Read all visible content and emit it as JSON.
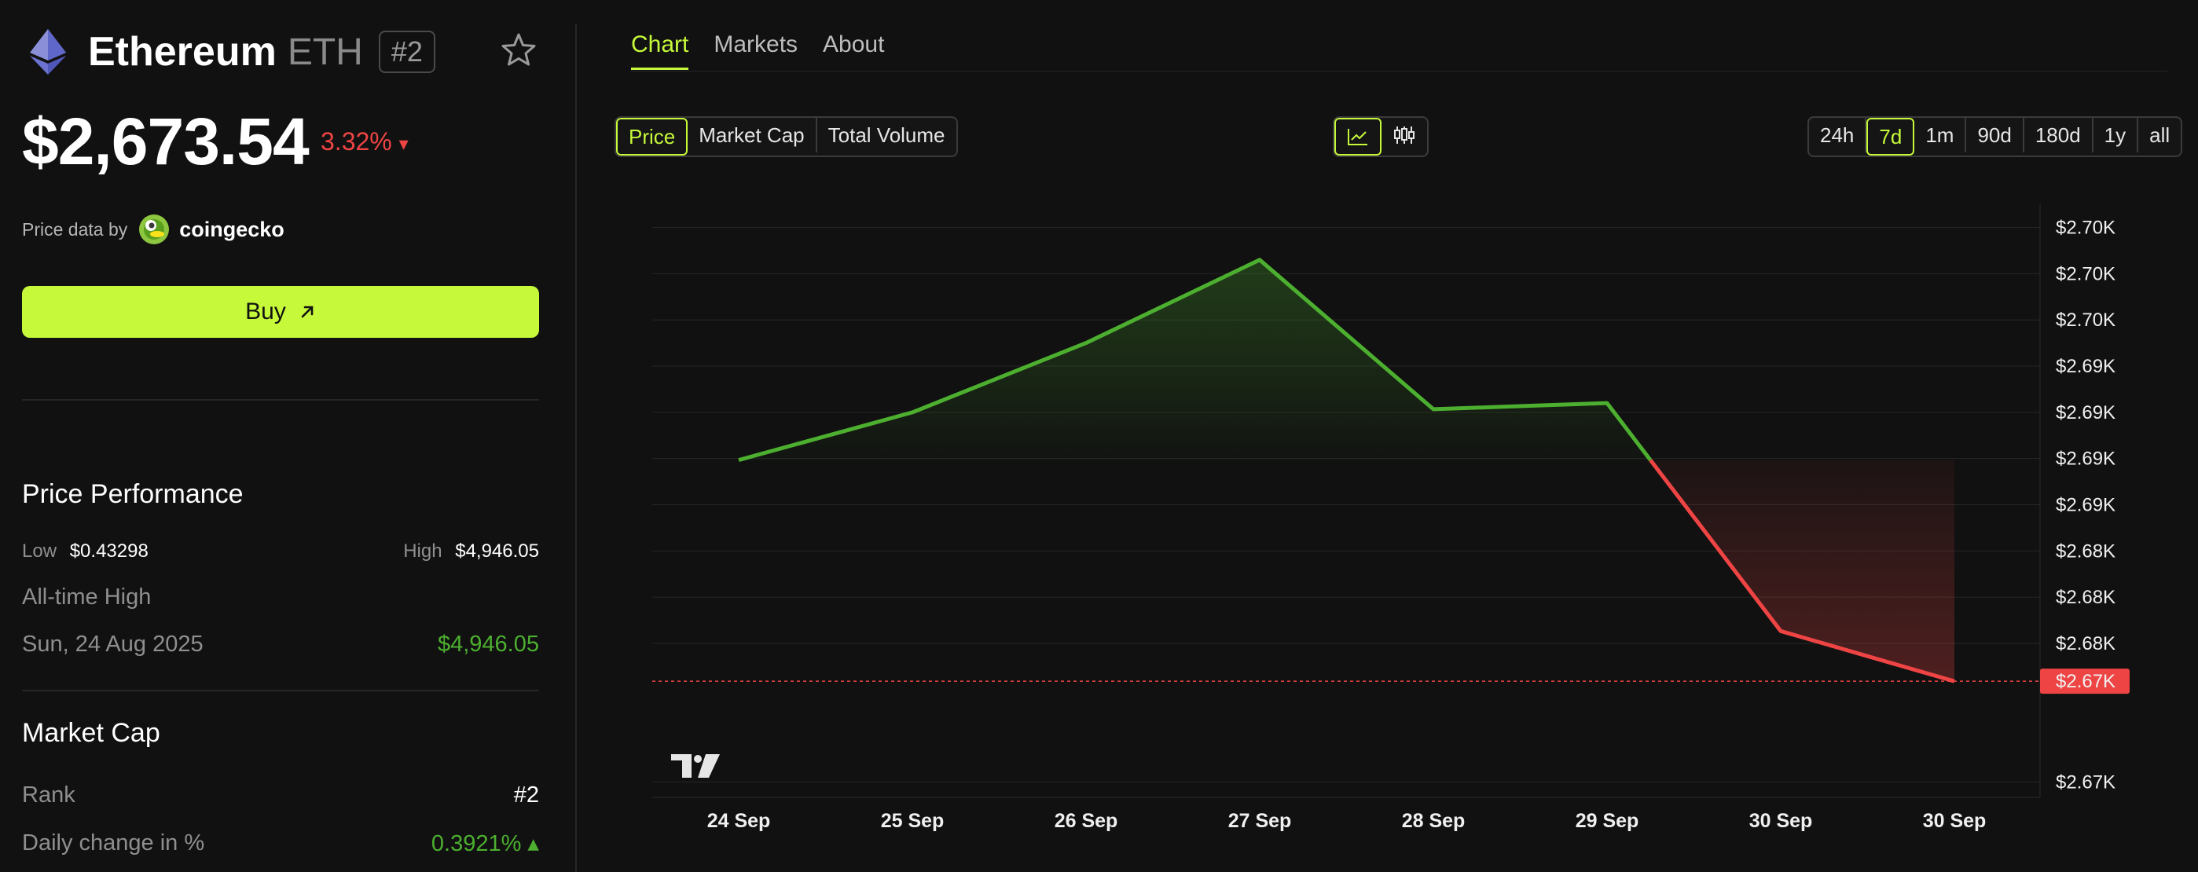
{
  "coin": {
    "name": "Ethereum",
    "symbol": "ETH",
    "rank_badge": "#2",
    "price": "$2,673.54",
    "change": "3.32%",
    "change_arrow": "▾"
  },
  "price_data": {
    "label": "Price data by",
    "provider": "coingecko"
  },
  "buy": {
    "label": "Buy"
  },
  "performance": {
    "title": "Price Performance",
    "low_label": "Low",
    "low_value": "$0.43298",
    "high_label": "High",
    "high_value": "$4,946.05",
    "ath_label": "All-time High",
    "ath_date": "Sun, 24 Aug 2025",
    "ath_value": "$4,946.05"
  },
  "market_cap": {
    "title": "Market Cap",
    "rank_label": "Rank",
    "rank_value": "#2",
    "daily_label": "Daily change in %",
    "daily_value": "0.3921% ▴"
  },
  "tabs": [
    "Chart",
    "Markets",
    "About"
  ],
  "metric_toggle": [
    "Price",
    "Market Cap",
    "Total Volume"
  ],
  "ranges": [
    "24h",
    "7d",
    "1m",
    "90d",
    "180d",
    "1y",
    "all"
  ],
  "colors": {
    "accent": "#c6f93a",
    "up": "#4caf2f",
    "down": "#ef4444",
    "bg": "#111111"
  },
  "icons": {
    "line_chart": "line-chart-icon",
    "candles": "candlestick-icon",
    "star": "star-icon",
    "arrow": "arrow-up-right-icon",
    "watermark": "tradingview-logo"
  },
  "chart_data": {
    "type": "line",
    "x": [
      "24 Sep",
      "25 Sep",
      "26 Sep",
      "27 Sep",
      "28 Sep",
      "29 Sep",
      "30 Sep",
      "30 Sep"
    ],
    "values": [
      2687.9,
      2691.0,
      2695.5,
      2700.9,
      2691.2,
      2691.6,
      2676.8,
      2673.54
    ],
    "ylim": [
      2666.0,
      2704.0
    ],
    "yticks": [
      {
        "v": 2703.0,
        "label": "$2.70K"
      },
      {
        "v": 2700.0,
        "label": "$2.70K"
      },
      {
        "v": 2697.0,
        "label": "$2.70K"
      },
      {
        "v": 2694.0,
        "label": "$2.69K"
      },
      {
        "v": 2691.0,
        "label": "$2.69K"
      },
      {
        "v": 2688.0,
        "label": "$2.69K"
      },
      {
        "v": 2685.0,
        "label": "$2.69K"
      },
      {
        "v": 2682.0,
        "label": "$2.68K"
      },
      {
        "v": 2679.0,
        "label": "$2.68K"
      },
      {
        "v": 2676.0,
        "label": "$2.68K"
      },
      {
        "v": 2667.0,
        "label": "$2.67K"
      }
    ],
    "last_label": "$2.67K",
    "grid": true
  }
}
